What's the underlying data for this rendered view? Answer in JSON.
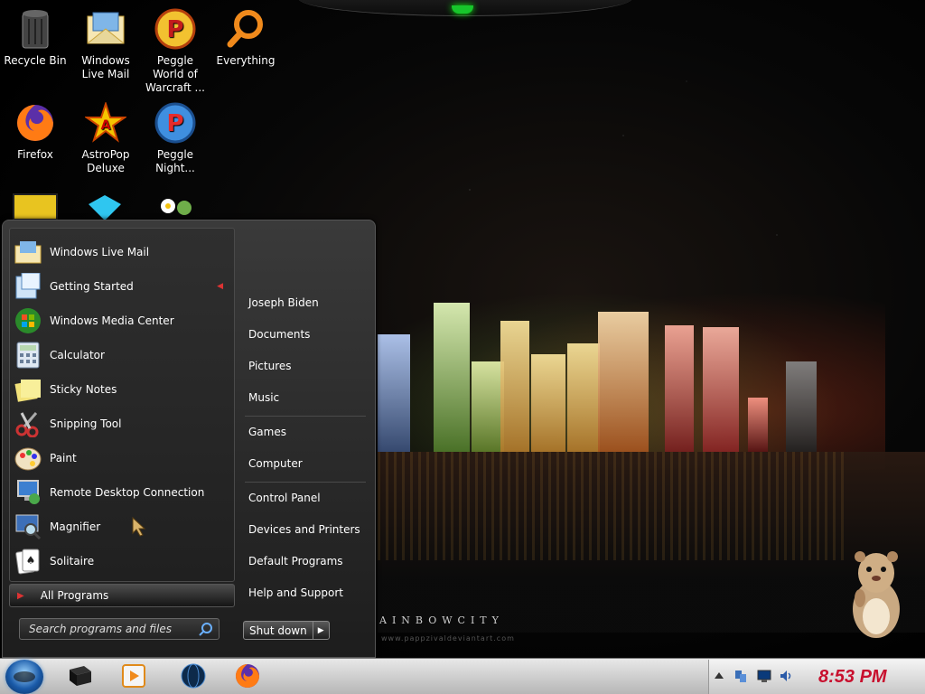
{
  "desktop": {
    "icons": [
      {
        "label": "Recycle Bin"
      },
      {
        "label": "Windows Live Mail"
      },
      {
        "label": "Peggle World of Warcraft ..."
      },
      {
        "label": "Everything"
      },
      {
        "label": "Firefox"
      },
      {
        "label": "AstroPop Deluxe"
      },
      {
        "label": "Peggle Night..."
      }
    ]
  },
  "wallpaper": {
    "brand_text": "AINBOWCITY",
    "credit_text": "www.pappzivaldeviantart.com"
  },
  "start_menu": {
    "programs": [
      {
        "label": "Windows Live Mail",
        "icon": "mail-icon"
      },
      {
        "label": "Getting Started",
        "icon": "getting-started-icon",
        "has_submenu": true
      },
      {
        "label": "Windows Media Center",
        "icon": "media-center-icon"
      },
      {
        "label": "Calculator",
        "icon": "calculator-icon"
      },
      {
        "label": "Sticky Notes",
        "icon": "sticky-notes-icon"
      },
      {
        "label": "Snipping Tool",
        "icon": "scissors-icon"
      },
      {
        "label": "Paint",
        "icon": "palette-icon"
      },
      {
        "label": "Remote Desktop Connection",
        "icon": "remote-desktop-icon"
      },
      {
        "label": "Magnifier",
        "icon": "magnifier-icon"
      },
      {
        "label": "Solitaire",
        "icon": "cards-icon"
      }
    ],
    "all_programs": "All Programs",
    "search_placeholder": "Search programs and files",
    "right_items": [
      {
        "label": "Joseph Biden"
      },
      {
        "label": "Documents"
      },
      {
        "label": "Pictures"
      },
      {
        "label": "Music"
      },
      {
        "label": "Games"
      },
      {
        "label": "Computer"
      },
      {
        "label": "Control Panel"
      },
      {
        "label": "Devices and Printers"
      },
      {
        "label": "Default Programs"
      },
      {
        "label": "Help and Support"
      }
    ],
    "shutdown_label": "Shut down"
  },
  "taskbar": {
    "pinned": [
      "computer-icon",
      "media-player-icon",
      "globe-icon",
      "firefox-icon"
    ],
    "tray_icons": [
      "show-hidden-icon",
      "network-icon",
      "monitor-icon",
      "volume-icon"
    ],
    "clock": "8:53 PM"
  },
  "colors": {
    "clock": "#c8102e",
    "accent_led": "#17c62b"
  }
}
